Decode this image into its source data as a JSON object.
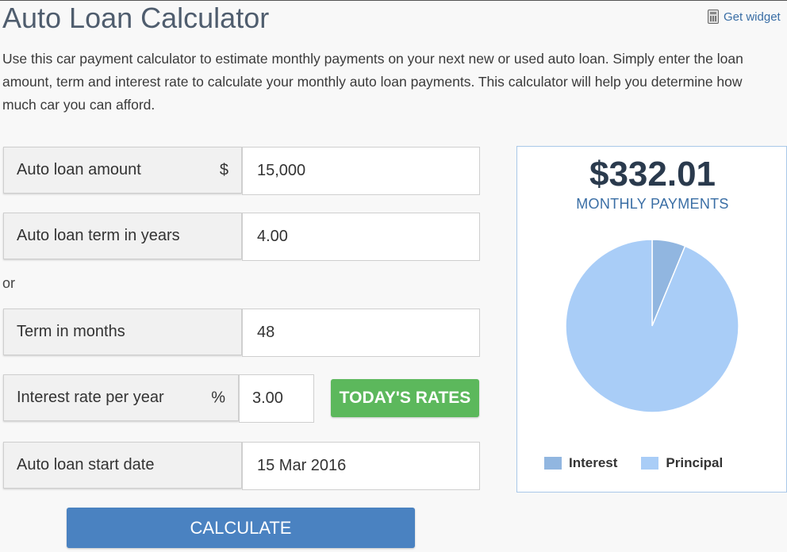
{
  "page": {
    "title": "Auto Loan Calculator",
    "widget_link": "Get widget",
    "intro": "Use this car payment calculator to estimate monthly payments on your next new or used auto loan. Simply enter the loan amount, term and interest rate to calculate your monthly auto loan payments. This calculator will help you determine how much car you can afford."
  },
  "form": {
    "amount": {
      "label": "Auto loan amount",
      "unit": "$",
      "value": "15,000"
    },
    "term_years": {
      "label": "Auto loan term in years",
      "value": "4.00"
    },
    "or_text": "or",
    "term_months": {
      "label": "Term in months",
      "value": "48"
    },
    "rate": {
      "label": "Interest rate per year",
      "unit": "%",
      "value": "3.00"
    },
    "start_date": {
      "label": "Auto loan start date",
      "value": "15 Mar 2016"
    },
    "rates_button": "TODAY'S RATES",
    "calculate_button": "CALCULATE"
  },
  "result": {
    "monthly_payment": "$332.01",
    "monthly_label": "MONTHLY PAYMENTS"
  },
  "chart_data": {
    "type": "pie",
    "slices": [
      {
        "name": "Interest",
        "value": 0.0623,
        "color": "#91b6e0"
      },
      {
        "name": "Principal",
        "value": 0.9377,
        "color": "#a9cdf7"
      }
    ]
  },
  "icons": {
    "widget": "calculator-icon"
  }
}
